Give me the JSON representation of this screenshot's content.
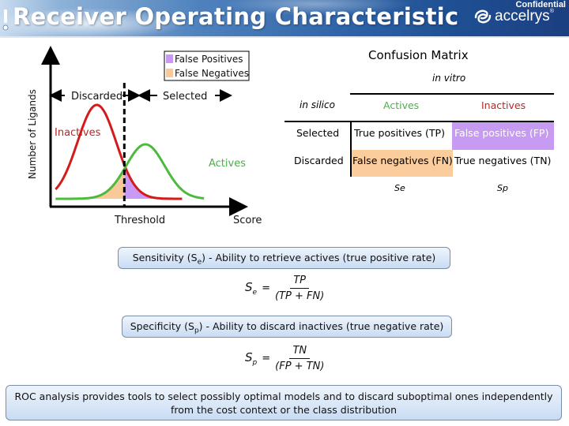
{
  "header": {
    "title": "Receiver Operating Characteristic",
    "confidential": "Confidential",
    "logo_text": "accelrys",
    "logo_mark": "®",
    "icons": [
      "slide-bullet-icon",
      "accelrys-swirl-icon"
    ]
  },
  "distribution_plot": {
    "y_axis_label": "Number of Ligands",
    "x_axis_label": "Score",
    "threshold_label": "Threshold",
    "discarded_label": "Discarded",
    "selected_label": "Selected",
    "inactives_label": "Inactives",
    "actives_label": "Actives",
    "legend": [
      {
        "label": "False Positives",
        "color": "#c899f5"
      },
      {
        "label": "False Negatives",
        "color": "#f9c99a"
      }
    ],
    "colors": {
      "inactives_curve": "#d41b1b",
      "actives_curve": "#4cba3c",
      "inactives_text": "#b02a2a",
      "actives_text": "#4cae4c"
    }
  },
  "chart_data": {
    "type": "line",
    "title": "",
    "xlabel": "Score",
    "ylabel": "Number of Ligands",
    "xlim": [
      0,
      10
    ],
    "ylim": [
      0,
      1
    ],
    "threshold": 3.85,
    "series": [
      {
        "name": "Inactives",
        "distribution": "normal",
        "mean": 2.35,
        "sd": 1.05,
        "peak": 1.0
      },
      {
        "name": "Actives",
        "distribution": "normal",
        "mean": 5.0,
        "sd": 1.05,
        "peak": 0.58
      }
    ],
    "shaded_regions": [
      {
        "name": "False Positives",
        "series": "Inactives",
        "side": "above-threshold"
      },
      {
        "name": "False Negatives",
        "series": "Actives",
        "side": "below-threshold"
      }
    ],
    "annotations": [
      "Discarded",
      "Selected",
      "Threshold",
      "Inactives",
      "Actives"
    ],
    "grid": false,
    "legend_position": "top-right"
  },
  "confusion_matrix": {
    "title": "Confusion Matrix",
    "column_group_label": "in vitro",
    "row_group_label": "in silico",
    "columns": [
      "Actives",
      "Inactives"
    ],
    "rows": [
      {
        "label": "Selected",
        "cells": [
          "True positives (TP)",
          "False positives (FP)"
        ]
      },
      {
        "label": "Discarded",
        "cells": [
          "False negatives (FN)",
          "True negatives (TN)"
        ]
      }
    ],
    "column_footers": [
      "Se",
      "Sp"
    ],
    "colors": {
      "fp": "#c79bf2",
      "fn": "#fbcc9c",
      "actives": "#4cae4c",
      "inactives": "#b02a2a"
    }
  },
  "definitions": [
    {
      "text_before": "Sensitivity (S",
      "sub": "e",
      "text_after": ") - Ability to retrieve actives (true positive rate)",
      "formula": {
        "symbol": "S",
        "sub": "e",
        "numerator": "TP",
        "denominator": "(TP + FN)"
      }
    },
    {
      "text_before": "Specificity (S",
      "sub": "p",
      "text_after": ") - Ability to discard inactives  (true negative rate)",
      "formula": {
        "symbol": "S",
        "sub": "p",
        "numerator": "TN",
        "denominator": "(FP + TN)"
      }
    }
  ],
  "footer": {
    "line1": "ROC analysis provides tools to select possibly optimal models and to discard suboptimal ones independently",
    "line2": "from the cost context or the class distribution"
  }
}
